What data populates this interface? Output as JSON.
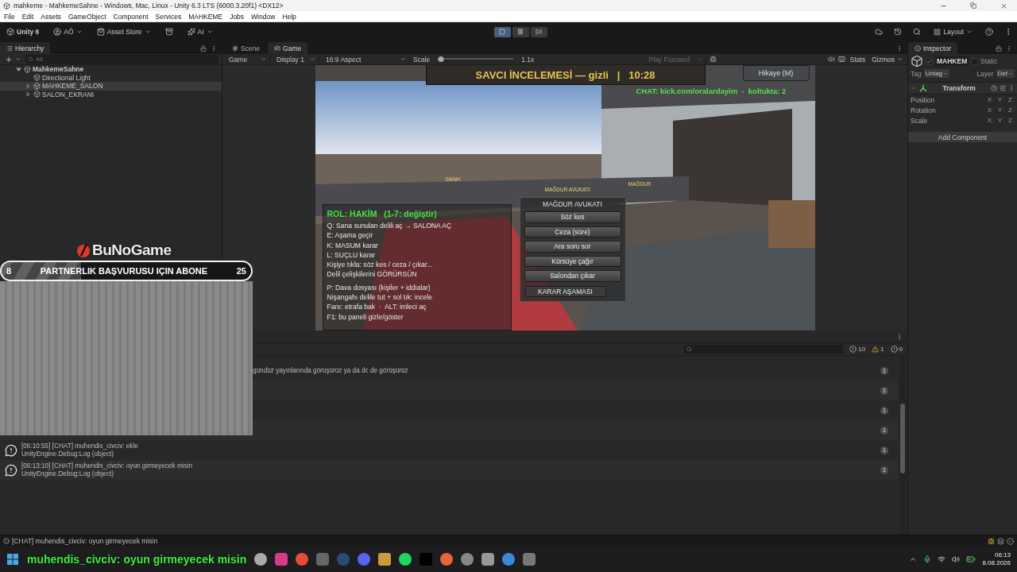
{
  "window": {
    "title": "mahkeme - MahkemeSahne - Windows, Mac, Linux - Unity 6.3 LTS (6000.3.20f1) <DX12>"
  },
  "menu": [
    "File",
    "Edit",
    "Assets",
    "GameObject",
    "Component",
    "Services",
    "MAHKEME",
    "Jobs",
    "Window",
    "Help"
  ],
  "toolbar": {
    "brand": "Unity 6",
    "account": "AÖ",
    "asset_store": "Asset Store",
    "ai": "AI",
    "playing": true,
    "paused": false,
    "layout": "Layout"
  },
  "hierarchy": {
    "title": "Hierarchy",
    "search_placeholder": "All",
    "items": [
      {
        "label": "MahkemeSahne",
        "kind": "scene",
        "expanded": true,
        "selected": false,
        "children": [
          {
            "label": "Directional Light",
            "kind": "object",
            "selected": false
          },
          {
            "label": "MAHKEME_SALON",
            "kind": "object",
            "expanded": false,
            "selected": true
          },
          {
            "label": "SALON_EKRANI",
            "kind": "object",
            "expanded": false,
            "selected": false
          }
        ]
      }
    ]
  },
  "view_tabs": [
    {
      "label": "Scene",
      "kind": "scene",
      "selected": false
    },
    {
      "label": "Game",
      "kind": "game",
      "selected": true
    }
  ],
  "game_toolbar": {
    "view": "Game",
    "display": "Display 1",
    "aspect": "16:9 Aspect",
    "scale_label": "Scale",
    "scale": {
      "level": 0.04
    },
    "scale_reading": "1.1x",
    "play_mode": "Play Focused",
    "stats": "Stats",
    "gizmos": "Gizmos"
  },
  "game_hud": {
    "banner": "SAVCI İNCELEMESİ — gizli   |   10:28",
    "story_button": "Hikaye (M)",
    "chat_line": "CHAT: kick.com/oralardayim  -  koltukta: 2",
    "world_labels": [
      "SANIK",
      "MAĞDUR AVUKATI",
      "MAĞDUR"
    ],
    "role_panel": {
      "title": "ROL: HAKİM   (1-7: değiştir)",
      "lines": [
        "Q: Sana sunulan delili aç → SALONA AÇ",
        "E: Aşama geçir",
        "K: MASUM karar",
        "L: SUÇLU karar",
        "Kişiye tıkla: söz kes / ceza / çıkar...",
        "Delil çelişkilerini GÖRÜRSÜN"
      ],
      "hints": [
        "P: Dava dosyası (kişiler + iddialar)",
        "Nişangahı delile tut + sol tık: incele",
        "Fare: etrafa bak  ·  ALT: imleci aç",
        "F1: bu paneli gizle/göster"
      ]
    },
    "action_menu": {
      "title": "MAĞDUR AVUKATI",
      "buttons": [
        "Söz kes",
        "Ceza (süre)",
        "Ara soru sor",
        "Kürsüye çağır",
        "Salondan çıkar"
      ],
      "primary": "KARAR AŞAMASI"
    }
  },
  "console": {
    "counts": {
      "logs": "10",
      "warnings": "1",
      "errors": "0"
    },
    "rows": [
      {
        "kind": "covered",
        "message": "gündüz yayınlarında görüşürüz ya da dc de görüşürüz",
        "count": "1"
      },
      {
        "kind": "covered",
        "count": "1"
      },
      {
        "kind": "covered",
        "count": "1"
      },
      {
        "kind": "covered",
        "count": "1"
      },
      {
        "kind": "log",
        "message": "[06:10:55] [CHAT] muhendis_civciv: ekle",
        "source": "UnityEngine.Debug:Log (object)",
        "count": "1"
      },
      {
        "kind": "log",
        "message": "[06:13:10] [CHAT] muhendis_civciv: oyun girmeyecek misin",
        "source": "UnityEngine.Debug:Log (object)",
        "count": "1"
      }
    ]
  },
  "inspector": {
    "title": "Inspector",
    "active": true,
    "name": "MAHKEM",
    "static_label": "Static",
    "is_static": false,
    "tag_label": "Tag",
    "tag": "Untag",
    "layer_label": "Layer",
    "layer": "Def",
    "component": {
      "title": "Transform",
      "expanded": true,
      "rows": [
        {
          "label": "Position",
          "axes": [
            "X",
            "Y",
            "Z"
          ]
        },
        {
          "label": "Rotation",
          "axes": [
            "X",
            "Y",
            "Z"
          ]
        },
        {
          "label": "Scale",
          "axes": [
            "X",
            "Y",
            "Z"
          ]
        }
      ]
    },
    "add_button": "Add Component"
  },
  "status_bar": "[CHAT] muhendis_civciv: oyun girmeyecek misin",
  "overlay": {
    "logo": "BuNoGame",
    "goal": {
      "current": "8",
      "label": "PARTNERLIK BAŞVURUSU IÇIN ABONE",
      "target": "25",
      "level": 0.32
    },
    "chat_ticker": "muhendis_civciv: oyun girmeyecek misin"
  },
  "taskbar": {
    "time": "06:13",
    "date": "8.08.2026"
  }
}
